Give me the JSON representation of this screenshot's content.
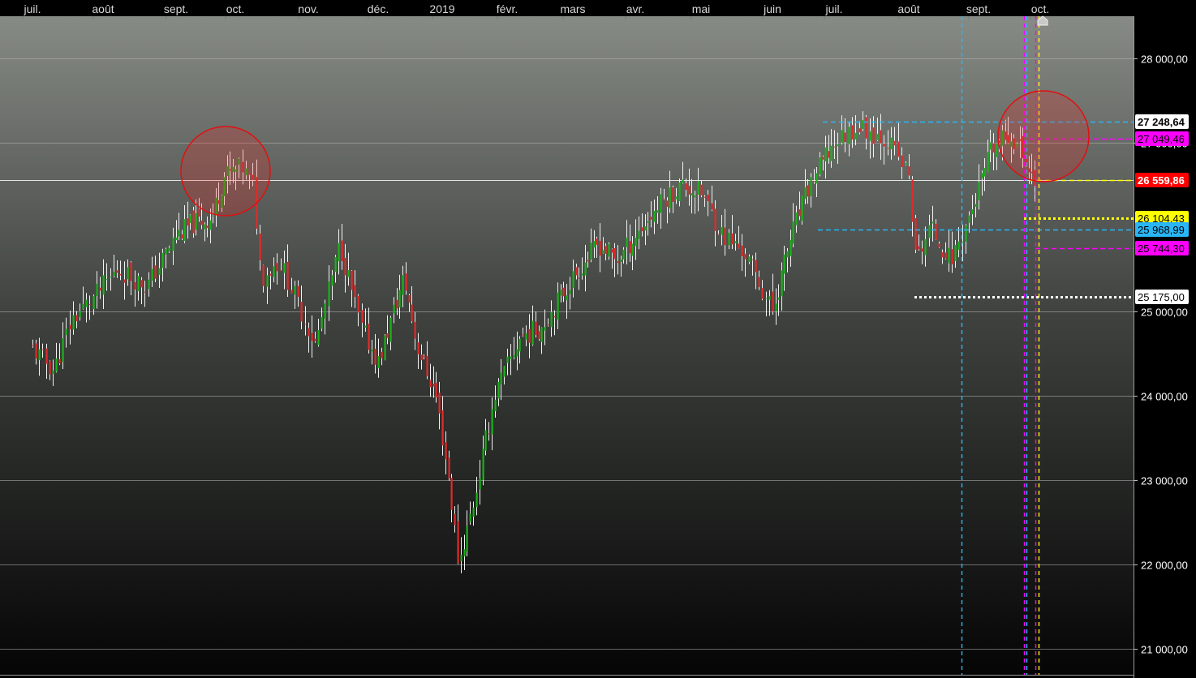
{
  "chart_data": {
    "type": "candlestick",
    "months": [
      "juil.",
      "août",
      "sept.",
      "oct.",
      "nov.",
      "déc.",
      "2019",
      "févr.",
      "mars",
      "avr.",
      "mai",
      "juin",
      "juil.",
      "août",
      "sept.",
      "oct."
    ],
    "y_axis": {
      "ylim": [
        20650,
        28500
      ],
      "ticks": [
        {
          "value": 28000,
          "label": "28 000,00"
        },
        {
          "value": 27000,
          "label": "27 000,00"
        },
        {
          "value": 25000,
          "label": "25 000,00"
        },
        {
          "value": 24000,
          "label": "24 000,00"
        },
        {
          "value": 23000,
          "label": "23 000,00"
        },
        {
          "value": 22000,
          "label": "22 000,00"
        },
        {
          "value": 21000,
          "label": "21 000,00"
        }
      ]
    },
    "price_tags": [
      {
        "value": 27248.64,
        "label": "27 248,64",
        "bg": "#ffffff",
        "fg": "#000000",
        "line": "#29b6f6",
        "style": "dashed",
        "bold": true
      },
      {
        "value": 27049.46,
        "label": "27 049,46",
        "bg": "#ff00ff",
        "fg": "#000000",
        "line": "#ff00ff",
        "style": "dashed",
        "bold": false
      },
      {
        "value": 26559.86,
        "label": "26 559,86",
        "bg": "#ff0000",
        "fg": "#ffffff",
        "line": "#ffff00",
        "style": "dashed",
        "bold": true
      },
      {
        "value": 26104.43,
        "label": "26 104,43",
        "bg": "#ffff00",
        "fg": "#000000",
        "line": "#ffff00",
        "style": "dotted",
        "bold": false
      },
      {
        "value": 25968.99,
        "label": "25 968,99",
        "bg": "#29b6f6",
        "fg": "#000000",
        "line": "#29b6f6",
        "style": "dashed",
        "bold": false
      },
      {
        "value": 25744.3,
        "label": "25 744,30",
        "bg": "#ff00ff",
        "fg": "#000000",
        "line": "#ff00ff",
        "style": "dashed",
        "bold": false
      },
      {
        "value": 25175.0,
        "label": "25 175,00",
        "bg": "#ffffff",
        "fg": "#000000",
        "line": "#ffffff",
        "style": "dotted",
        "bold": false
      }
    ],
    "anchors": [
      {
        "month": 0,
        "value": 24550
      },
      {
        "month": 0.3,
        "value": 24300
      },
      {
        "month": 0.55,
        "value": 24900
      },
      {
        "month": 0.9,
        "value": 25200
      },
      {
        "month": 1.2,
        "value": 25500
      },
      {
        "month": 1.6,
        "value": 25300
      },
      {
        "month": 2.0,
        "value": 25900
      },
      {
        "month": 2.3,
        "value": 26050
      },
      {
        "month": 2.6,
        "value": 26100
      },
      {
        "month": 2.8,
        "value": 26600
      },
      {
        "month": 3.1,
        "value": 26700
      },
      {
        "month": 3.25,
        "value": 26450
      },
      {
        "month": 3.35,
        "value": 25400
      },
      {
        "month": 3.6,
        "value": 25600
      },
      {
        "month": 3.9,
        "value": 25000
      },
      {
        "month": 4.1,
        "value": 24600
      },
      {
        "month": 4.45,
        "value": 25800
      },
      {
        "month": 4.75,
        "value": 24800
      },
      {
        "month": 5.0,
        "value": 24400
      },
      {
        "month": 5.4,
        "value": 25400
      },
      {
        "month": 5.6,
        "value": 24600
      },
      {
        "month": 5.9,
        "value": 24000
      },
      {
        "month": 6.1,
        "value": 23000
      },
      {
        "month": 6.25,
        "value": 22000
      },
      {
        "month": 6.5,
        "value": 22800
      },
      {
        "month": 6.8,
        "value": 24000
      },
      {
        "month": 7.2,
        "value": 24700
      },
      {
        "month": 7.5,
        "value": 24800
      },
      {
        "month": 8.0,
        "value": 25400
      },
      {
        "month": 8.4,
        "value": 25800
      },
      {
        "month": 8.7,
        "value": 25600
      },
      {
        "month": 9.0,
        "value": 25900
      },
      {
        "month": 9.4,
        "value": 26300
      },
      {
        "month": 9.7,
        "value": 26500
      },
      {
        "month": 10.0,
        "value": 26400
      },
      {
        "month": 10.3,
        "value": 25900
      },
      {
        "month": 10.6,
        "value": 25700
      },
      {
        "month": 11.0,
        "value": 25000
      },
      {
        "month": 11.3,
        "value": 25900
      },
      {
        "month": 11.6,
        "value": 26500
      },
      {
        "month": 12.0,
        "value": 27000
      },
      {
        "month": 12.3,
        "value": 27200
      },
      {
        "month": 12.7,
        "value": 27050
      },
      {
        "month": 13.0,
        "value": 26600
      },
      {
        "month": 13.1,
        "value": 25600
      },
      {
        "month": 13.3,
        "value": 26000
      },
      {
        "month": 13.6,
        "value": 25600
      },
      {
        "month": 13.85,
        "value": 26100
      },
      {
        "month": 14.2,
        "value": 26900
      },
      {
        "month": 14.5,
        "value": 27100
      },
      {
        "month": 14.7,
        "value": 26900
      },
      {
        "month": 14.85,
        "value": 26600
      },
      {
        "month": 14.95,
        "value": 26560
      }
    ]
  }
}
